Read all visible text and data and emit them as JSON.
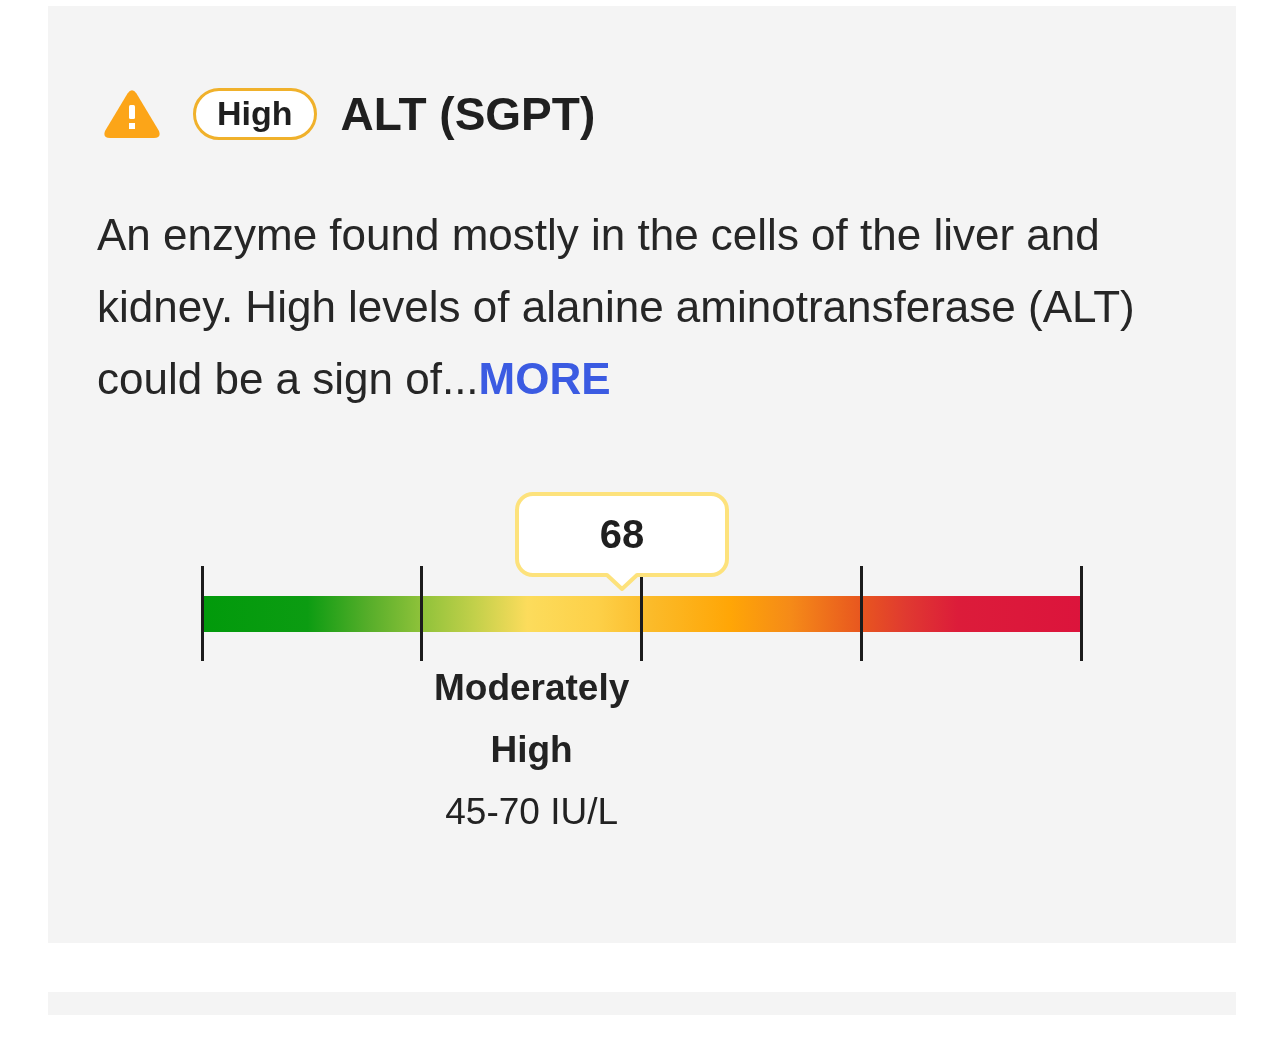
{
  "header": {
    "badge": "High",
    "title": "ALT (SGPT)"
  },
  "description": {
    "text": "An enzyme found mostly in the cells of the liver and kidney. High levels of alanine aminotransferase (ALT) could be a sign of...",
    "link": "MORE"
  },
  "gauge": {
    "marker": {
      "value": "68",
      "level": 0.478
    },
    "range_label": {
      "name": "Moderately High",
      "range": "45-70 IU/L"
    }
  }
}
